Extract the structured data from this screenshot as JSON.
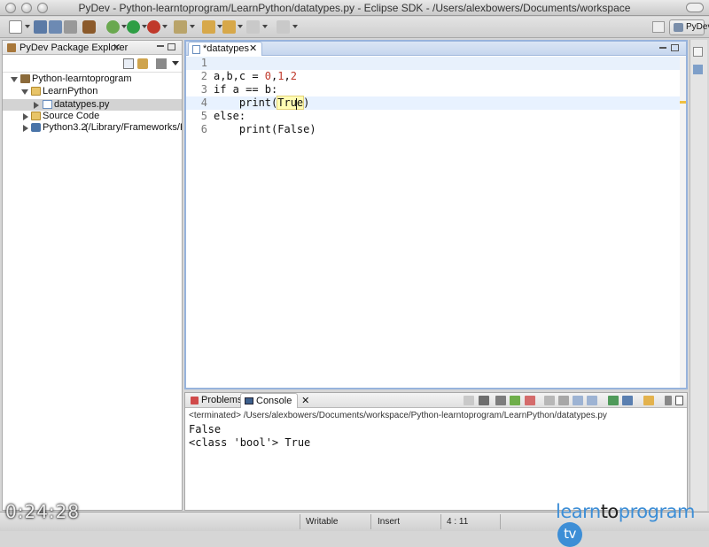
{
  "window": {
    "title": "PyDev - Python-learntoprogram/LearnPython/datatypes.py - Eclipse SDK - /Users/alexbowers/Documents/workspace"
  },
  "toolbar": {
    "perspective_label": "PyDev"
  },
  "package_explorer": {
    "title": "PyDev Package Explorer",
    "tree": [
      {
        "label": "Python-learntoprogram",
        "depth": 0,
        "expanded": true,
        "icon": "project-icon"
      },
      {
        "label": "LearnPython",
        "depth": 1,
        "expanded": true,
        "icon": "folder-icon"
      },
      {
        "label": "datatypes.py",
        "depth": 2,
        "expanded": false,
        "icon": "python-file-icon",
        "selected": true
      },
      {
        "label": "Source Code",
        "depth": 1,
        "expanded": false,
        "icon": "folder-icon"
      },
      {
        "label": "Python3.2",
        "suffix": "(/Library/Frameworks/Pyt",
        "depth": 1,
        "expanded": false,
        "icon": "python-interpreter-icon"
      }
    ]
  },
  "editor": {
    "tab_label": "*datatypes",
    "lines": [
      {
        "n": "1",
        "code": ""
      },
      {
        "n": "2",
        "code": "a,b,c = 0,1,2"
      },
      {
        "n": "3",
        "code": "if a == b:"
      },
      {
        "n": "4",
        "code": "    print(True)"
      },
      {
        "n": "5",
        "code": "else:"
      },
      {
        "n": "6",
        "code": "    print(False)"
      }
    ]
  },
  "console": {
    "tabs": {
      "problems": "Problems",
      "console": "Console"
    },
    "terminated_path": "<terminated> /Users/alexbowers/Documents/workspace/Python-learntoprogram/LearnPython/datatypes.py",
    "output": "False\n<class 'bool'> True"
  },
  "statusbar": {
    "writable": "Writable",
    "insert": "Insert",
    "position": "4 : 11"
  },
  "overlay": {
    "timestamp": "0:24:28",
    "brand_learn": "learn",
    "brand_to": "to",
    "brand_program": "program",
    "brand_tv": "tv"
  }
}
